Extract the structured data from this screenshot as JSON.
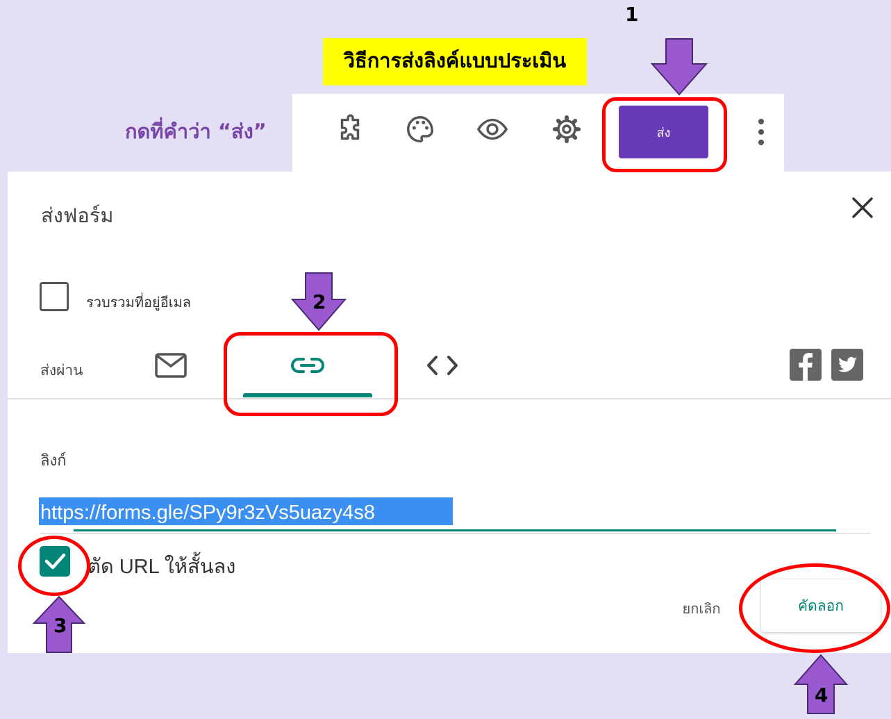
{
  "heading": {
    "title": "วิธีการส่งลิงค์แบบประเมิน",
    "hint": "กดที่คำว่า “ส่ง”"
  },
  "toolbar": {
    "send_label": "ส่ง",
    "icons": [
      "addon-puzzle-icon",
      "palette-icon",
      "preview-eye-icon",
      "settings-gear-icon",
      "more-vert-icon"
    ]
  },
  "dialog": {
    "title": "ส่งฟอร์ม",
    "collect_email_label": "รวบรวมที่อยู่อีเมล",
    "collect_email_checked": false,
    "send_via_label": "ส่งผ่าน",
    "tabs": [
      "email-icon",
      "link-icon",
      "embed-code-icon"
    ],
    "active_tab": "link-icon",
    "link_label": "ลิงก์",
    "link_url": "https://forms.gle/SPy9r3zVs5uazy4s8",
    "shorten_label": "ตัด URL ให้สั้นลง",
    "shorten_checked": true,
    "cancel_label": "ยกเลิก",
    "copy_label": "คัดลอก"
  },
  "annotations": {
    "step1": "1",
    "step2": "2",
    "step3": "3",
    "step4": "4"
  },
  "colors": {
    "background": "#e3dff5",
    "accent": "#673ab7",
    "teal": "#008577",
    "annotation_red": "#ff0000",
    "arrow_purple": "#9b59d0",
    "title_highlight": "#ffff00"
  }
}
